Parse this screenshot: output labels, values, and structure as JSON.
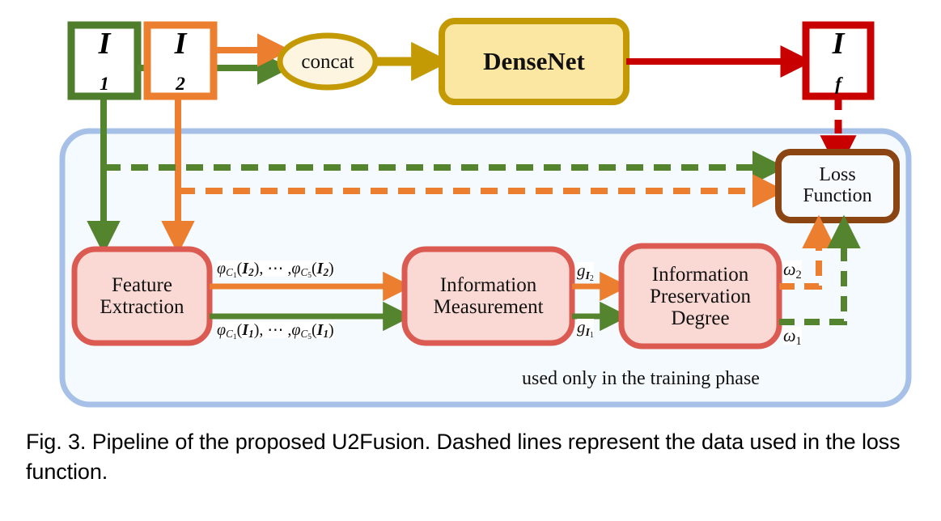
{
  "figure": {
    "caption": "Fig. 3. Pipeline of the proposed U2Fusion. Dashed lines represent the data used in the loss function.",
    "training_note": "used only in the training phase"
  },
  "colors": {
    "green": "#55842F",
    "orange": "#EC7F2F",
    "gold": "#C49A04",
    "cream": "#FDF5E0",
    "red": "#C80000",
    "pink_fill": "#FAD9D4",
    "pink_border": "#DB5B52",
    "brown": "#8B4513",
    "blue_border": "#A6C0E8",
    "panel_fill": "#F5FAFE",
    "yellow_fill": "#FBE6A2",
    "black": "#000000"
  },
  "nodes": {
    "input1": {
      "label": "I",
      "subscript": "1",
      "name": "I1"
    },
    "input2": {
      "label": "I",
      "subscript": "2",
      "name": "I2"
    },
    "concat": {
      "label": "concat"
    },
    "densenet": {
      "label": "DenseNet"
    },
    "fused": {
      "label": "I",
      "subscript": "f",
      "name": "If"
    },
    "loss_function": {
      "lines": [
        "Loss",
        "Function"
      ]
    },
    "feature_extraction": {
      "lines": [
        "Feature",
        "Extraction"
      ]
    },
    "information_measurement": {
      "lines": [
        "Information",
        "Measurement"
      ]
    },
    "information_preservation_degree": {
      "lines": [
        "Information",
        "Preservation",
        "Degree"
      ]
    }
  },
  "edge_labels": {
    "phi_i2": {
      "prefix": "φ",
      "sub1": "C",
      "sub1sub": "1",
      "arg1": "I",
      "arg1sub": "2",
      "dots": ", ⋯ ,",
      "sub2": "C",
      "sub2sub": "5",
      "arg2": "I",
      "arg2sub": "2"
    },
    "phi_i1": {
      "prefix": "φ",
      "sub1": "C",
      "sub1sub": "1",
      "arg1": "I",
      "arg1sub": "1",
      "dots": ", ⋯ ,",
      "sub2": "C",
      "sub2sub": "5",
      "arg2": "I",
      "arg2sub": "1"
    },
    "g_i2": {
      "symbol": "g",
      "sub": "I",
      "subsub": "2"
    },
    "g_i1": {
      "symbol": "g",
      "sub": "I",
      "subsub": "1"
    },
    "omega_2": {
      "symbol": "ω",
      "sub": "2"
    },
    "omega_1": {
      "symbol": "ω",
      "sub": "1"
    }
  }
}
